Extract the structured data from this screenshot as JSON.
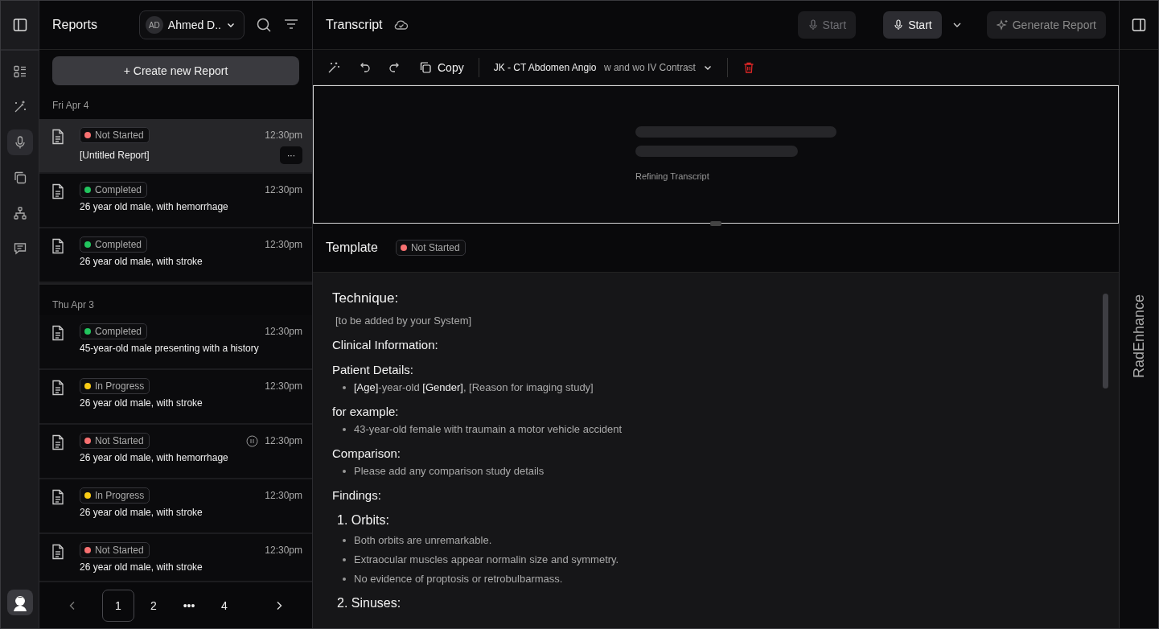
{
  "rail": {
    "items": [
      {
        "selected": false
      },
      {
        "selected": false
      },
      {
        "selected": true
      },
      {
        "selected": false
      },
      {
        "selected": false
      },
      {
        "selected": false
      }
    ]
  },
  "reports": {
    "title": "Reports",
    "user": {
      "initials": "AD",
      "name": "Ahmed D.."
    },
    "create_button": "+ Create new Report",
    "groups": [
      {
        "date": "Fri Apr 4",
        "items": [
          {
            "status": "Not Started",
            "color": "#f87171",
            "time": "12:30pm",
            "title": "[Untitled Report]",
            "selected": true,
            "paused": false,
            "more": "···"
          },
          {
            "status": "Completed",
            "color": "#22c55e",
            "time": "12:30pm",
            "title": "26 year old male, with hemorrhage",
            "selected": false,
            "paused": false
          },
          {
            "status": "Completed",
            "color": "#22c55e",
            "time": "12:30pm",
            "title": "26 year old male, with stroke",
            "selected": false,
            "paused": false
          }
        ]
      },
      {
        "date": "Thu Apr 3",
        "items": [
          {
            "status": "Completed",
            "color": "#22c55e",
            "time": "12:30pm",
            "title": "45-year-old male presenting with a history",
            "selected": false,
            "paused": false
          },
          {
            "status": "In Progress",
            "color": "#facc15",
            "time": "12:30pm",
            "title": "26 year old male, with stroke",
            "selected": false,
            "paused": false
          },
          {
            "status": "Not Started",
            "color": "#f87171",
            "time": "12:30pm",
            "title": "26 year old male, with hemorrhage",
            "selected": false,
            "paused": true
          },
          {
            "status": "In Progress",
            "color": "#facc15",
            "time": "12:30pm",
            "title": "26 year old male, with stroke",
            "selected": false,
            "paused": false
          },
          {
            "status": "Not Started",
            "color": "#f87171",
            "time": "12:30pm",
            "title": "26 year old male, with stroke",
            "selected": false,
            "paused": false
          }
        ]
      }
    ],
    "pagination": [
      {
        "label": "1",
        "selected": true
      },
      {
        "label": "2",
        "selected": false
      },
      {
        "label": "•••",
        "selected": false
      },
      {
        "label": "4",
        "selected": false
      }
    ]
  },
  "transcript": {
    "title": "Transcript",
    "buttons": [
      {
        "label": "Start",
        "disabled": true
      },
      {
        "label": "Start",
        "disabled": false
      }
    ],
    "generate_button": "Generate Report",
    "copy": "Copy",
    "template_name": "JK - CT Abdomen Angio",
    "template_suffix": "w and wo IV Contrast",
    "loading_text": "Refining Transcript"
  },
  "template": {
    "title": "Template",
    "status": "Not Started",
    "color": "#f87171",
    "blocks": [
      {
        "kind": "heading",
        "text": "Technique:"
      },
      {
        "kind": "text",
        "text": "[to be added by your System]"
      },
      {
        "kind": "heading",
        "text": "Clinical Information:"
      },
      {
        "kind": "heading",
        "text": "Patient Details:"
      },
      {
        "kind": "bullet",
        "parts": [
          {
            "text": "[Age]",
            "strong": true
          },
          {
            "text": "-year-old ",
            "strong": false
          },
          {
            "text": "[Gender]",
            "strong": true
          },
          {
            "text": ", [Reason for imaging study]",
            "strong": false
          }
        ]
      },
      {
        "kind": "heading",
        "text": "for example:"
      },
      {
        "kind": "bullet",
        "text": "43-year-old female with traumain a motor vehicle accident"
      },
      {
        "kind": "heading",
        "text": "Comparison:"
      },
      {
        "kind": "bullet",
        "text": "Please add any comparison study details"
      },
      {
        "kind": "heading",
        "text": "Findings:"
      },
      {
        "kind": "numbered",
        "number": "1.",
        "text": "Orbits:"
      },
      {
        "kind": "bullet",
        "text": "Both orbits are unremarkable."
      },
      {
        "kind": "bullet",
        "text": "Extraocular muscles appear normalin size and symmetry."
      },
      {
        "kind": "bullet",
        "text": "No evidence of proptosis or retrobulbarmass."
      },
      {
        "kind": "numbered",
        "number": "2.",
        "text": "Sinuses:"
      }
    ]
  },
  "brand": "RadEnhance"
}
